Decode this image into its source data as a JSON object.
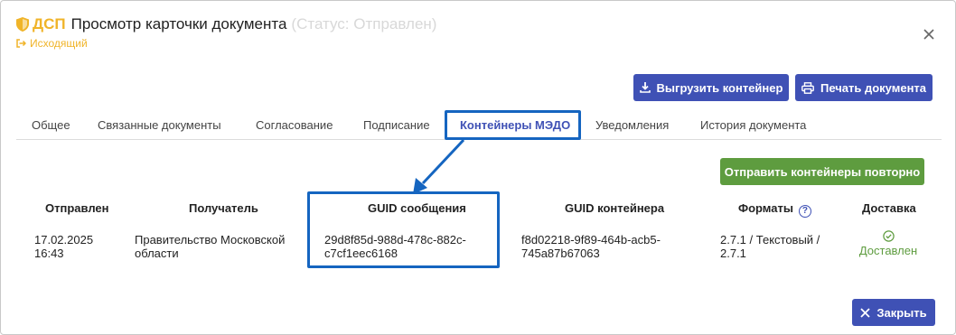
{
  "header": {
    "dsp_label": "ДСП",
    "title": "Просмотр карточки документа",
    "status": "(Статус: Отправлен)",
    "direction": "Исходящий"
  },
  "toolbar": {
    "export_label": "Выгрузить контейнер",
    "print_label": "Печать документа"
  },
  "tabs": [
    {
      "label": "Общее"
    },
    {
      "label": "Связанные документы"
    },
    {
      "label": "Согласование"
    },
    {
      "label": "Подписание"
    },
    {
      "label": "Контейнеры МЭДО",
      "active": true
    },
    {
      "label": "Уведомления"
    },
    {
      "label": "История документа"
    }
  ],
  "resend_label": "Отправить контейнеры повторно",
  "table": {
    "columns": [
      "Отправлен",
      "Получатель",
      "GUID сообщения",
      "GUID контейнера",
      "Форматы",
      "Доставка"
    ],
    "rows": [
      {
        "sent": "17.02.2025 16:43",
        "recipient": "Правительство Московской области",
        "message_guid": "29d8f85d-988d-478c-882c-c7cf1eec6168",
        "container_guid": "f8d02218-9f89-464b-acb5-745a87b67063",
        "formats": "2.7.1 / Текстовый / 2.7.1",
        "delivery": "Доставлен"
      }
    ]
  },
  "footer": {
    "close_label": "Закрыть"
  },
  "colors": {
    "primary": "#3f51b5",
    "success": "#5e9c3f",
    "warning": "#f0b429",
    "annotation": "#1565c0"
  },
  "icons": [
    "shield-icon",
    "exit-icon",
    "close-icon",
    "download-icon",
    "printer-icon",
    "help-icon",
    "check-circle-icon",
    "x-icon"
  ]
}
